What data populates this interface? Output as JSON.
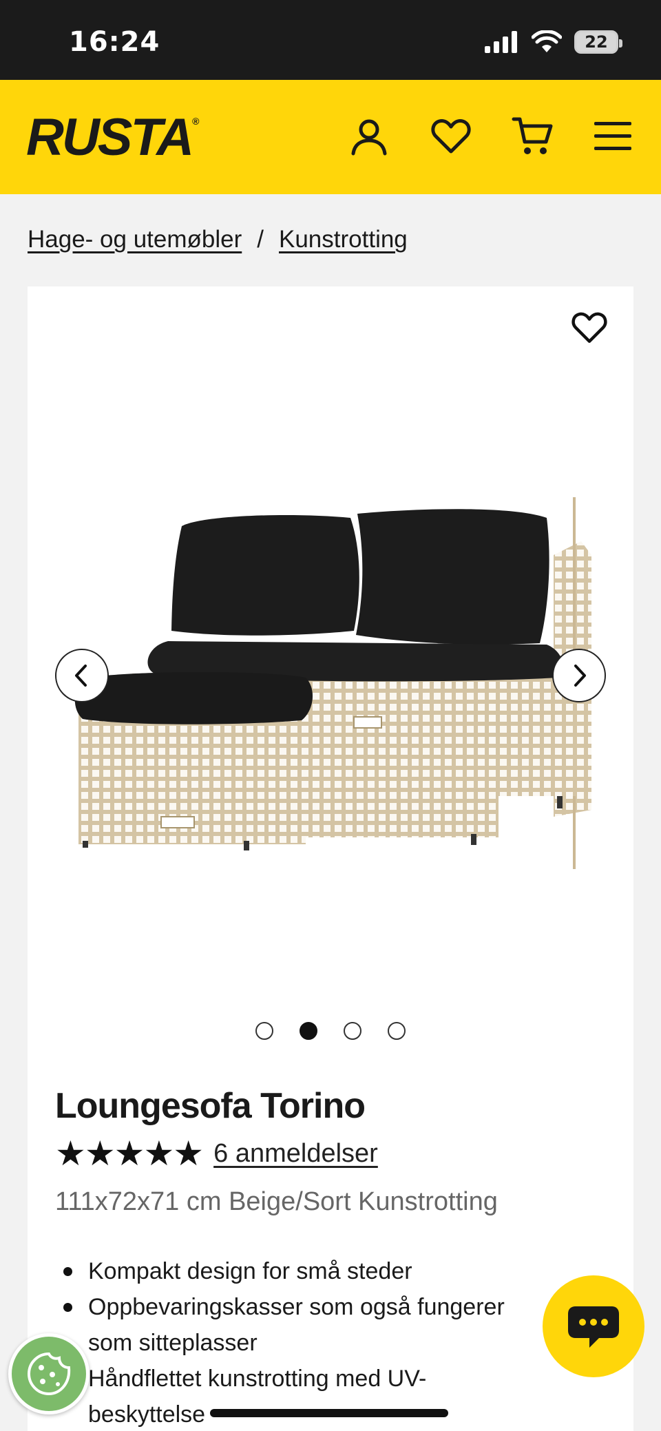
{
  "status_bar": {
    "time": "16:24",
    "battery_level": "22"
  },
  "header": {
    "logo": "RUSTA",
    "logo_mark": "®",
    "icons": [
      "account-icon",
      "heart-icon",
      "cart-icon",
      "menu-icon"
    ],
    "accent_color": "#ffd60a"
  },
  "breadcrumb": {
    "items": [
      {
        "label": "Hage- og utemøbler"
      },
      {
        "label": "Kunstrotting"
      }
    ],
    "separator": "/"
  },
  "gallery": {
    "image_count": 4,
    "active_index": 1
  },
  "product": {
    "title": "Loungesofa Torino",
    "rating_stars": "★★★★★",
    "rating_value": 5,
    "reviews_label": "6 anmeldelser",
    "subtitle": "111x72x71 cm Beige/Sort Kunstrotting",
    "features": [
      "Kompakt design for små steder",
      "Oppbevaringskasser som også fungerer",
      "som sitteplasser",
      "Håndflettet kunstrotting med UV-",
      "beskyttelse"
    ]
  }
}
